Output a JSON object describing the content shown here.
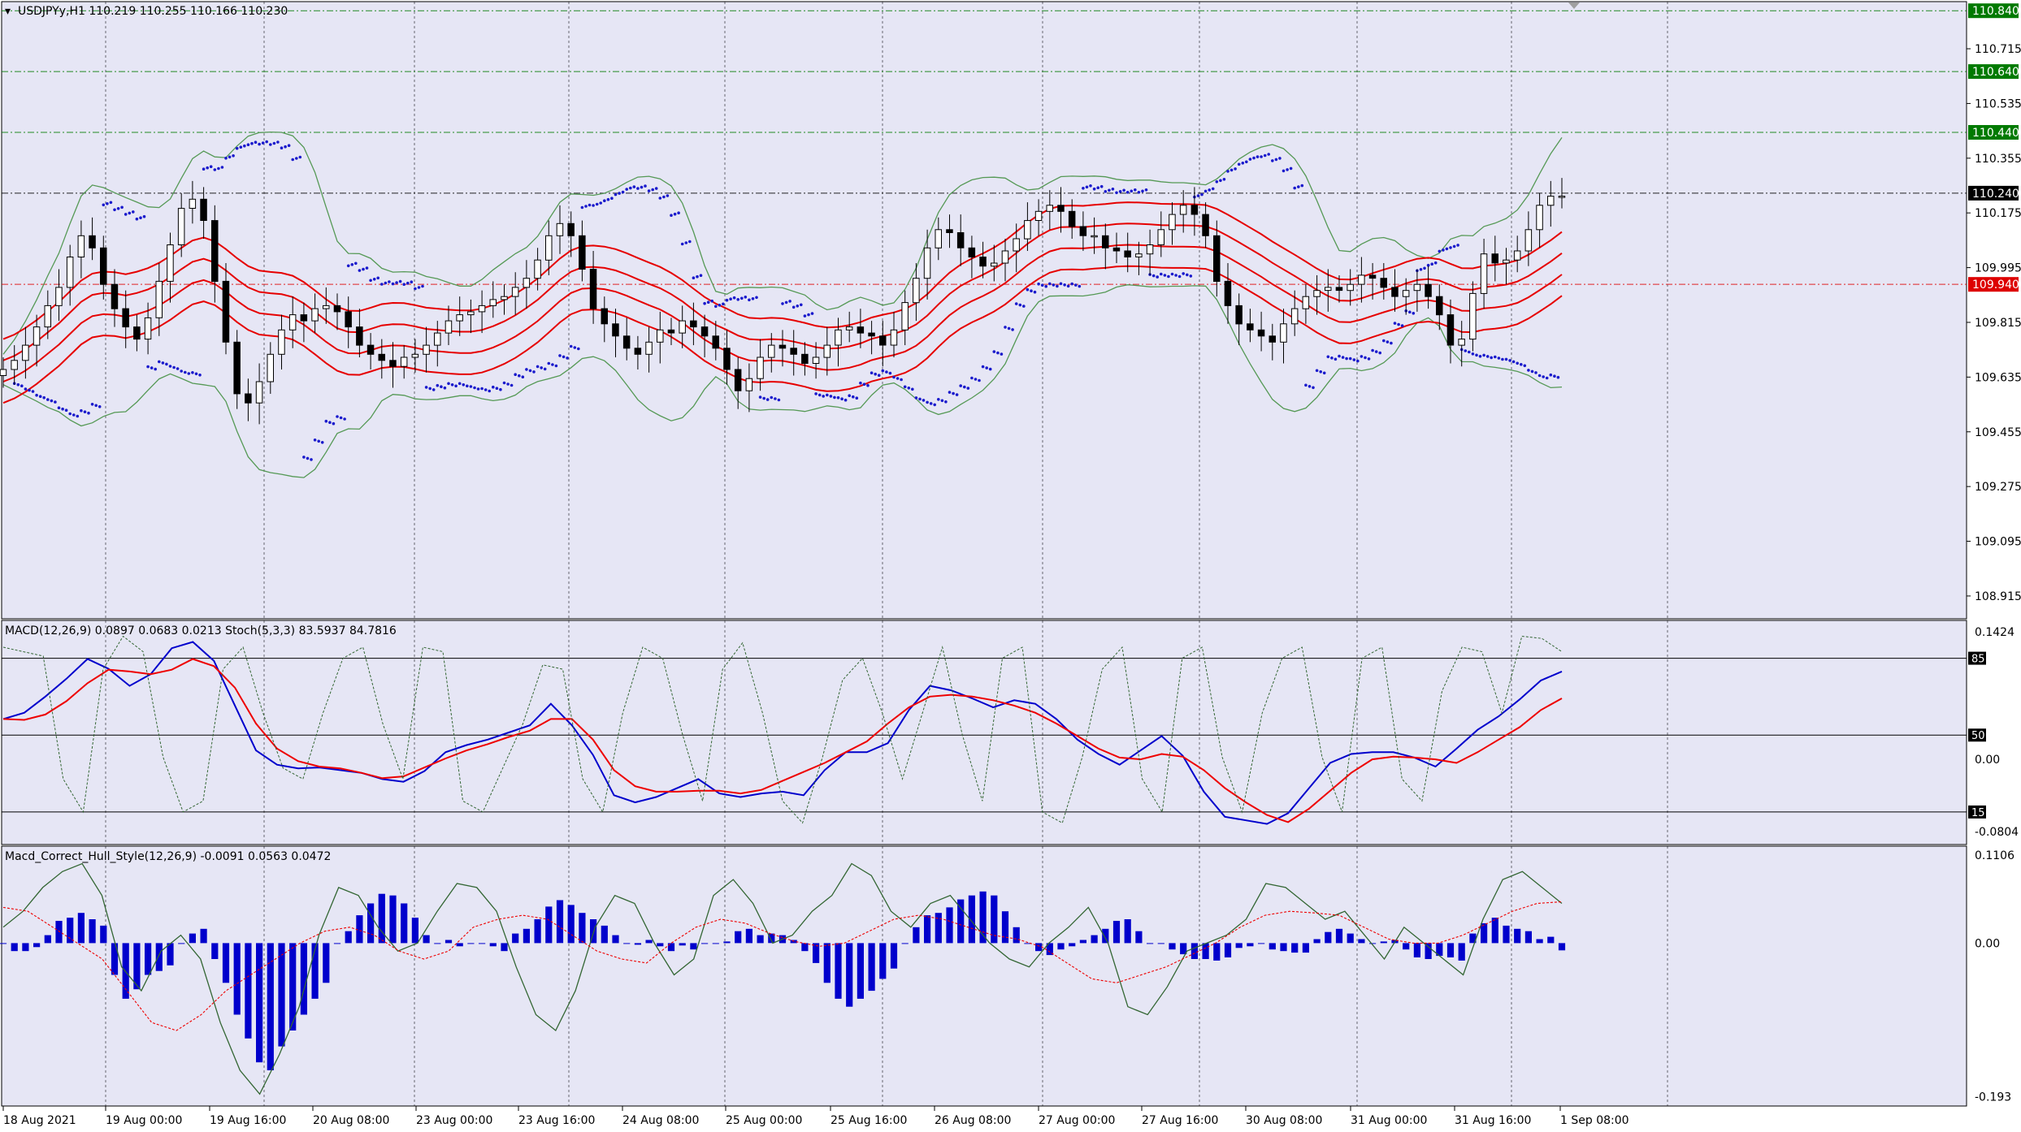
{
  "window": {
    "header": "USDJPYy,H1  110.219 110.255 110.166 110.230"
  },
  "panes": {
    "price": {
      "ticks": [
        "110.715",
        "110.535",
        "110.355",
        "110.175",
        "109.995",
        "109.815",
        "109.635",
        "109.455",
        "109.275",
        "109.095",
        "108.915"
      ]
    },
    "macd": {
      "label": "MACD(12,26,9) 0.0897 0.0683 0.0213  Stoch(5,3,3) 83.5937 84.7816",
      "ticks": [
        "0.1424",
        "0.00",
        "-0.0804"
      ],
      "level_labels": [
        "85",
        "50",
        "15"
      ]
    },
    "hull": {
      "label": "Macd_Correct_Hull_Style(12,26,9) -0.0091 0.0563 0.0472",
      "ticks": [
        "0.1106",
        "0.00",
        "-0.193"
      ]
    }
  },
  "price_tags": [
    "110.840",
    "110.640",
    "110.440",
    "110.240",
    "109.940"
  ],
  "time_labels": [
    "18 Aug 2021",
    "19 Aug 00:00",
    "19 Aug 16:00",
    "20 Aug 08:00",
    "23 Aug 00:00",
    "23 Aug 16:00",
    "24 Aug 08:00",
    "25 Aug 00:00",
    "25 Aug 16:00",
    "26 Aug 08:00",
    "27 Aug 00:00",
    "27 Aug 16:00",
    "30 Aug 08:00",
    "31 Aug 00:00",
    "31 Aug 16:00",
    "1 Sep 08:00"
  ],
  "colors": {
    "background": "#e6e6f5",
    "grid": "#000000",
    "bull_candle": "#ffffff",
    "bear_candle": "#000000",
    "ma_red": "#e60000",
    "bollinger": "#559955",
    "psar": "#1a1acc",
    "macd_blue": "#0000cc",
    "signal_red": "#ee0000",
    "stoch_green": "#336633",
    "tag_green": "#007a00",
    "tag_black": "#000000",
    "tag_red": "#dd0000"
  },
  "chart_data": [
    {
      "type": "candlestick",
      "symbol": "USDJPYy",
      "timeframe": "H1",
      "ohlc_last": {
        "open": 110.219,
        "high": 110.255,
        "low": 110.166,
        "close": 110.23
      },
      "ylim": [
        108.84,
        110.87
      ],
      "closes": [
        109.66,
        109.69,
        109.74,
        109.8,
        109.87,
        109.93,
        110.03,
        110.1,
        110.06,
        109.94,
        109.86,
        109.8,
        109.76,
        109.83,
        109.95,
        110.07,
        110.19,
        110.22,
        110.15,
        109.95,
        109.75,
        109.58,
        109.55,
        109.62,
        109.71,
        109.79,
        109.84,
        109.82,
        109.86,
        109.87,
        109.85,
        109.8,
        109.74,
        109.71,
        109.69,
        109.67,
        109.7,
        109.71,
        109.74,
        109.78,
        109.82,
        109.84,
        109.85,
        109.87,
        109.89,
        109.9,
        109.93,
        109.96,
        110.02,
        110.1,
        110.14,
        110.1,
        109.99,
        109.86,
        109.81,
        109.77,
        109.73,
        109.71,
        109.75,
        109.79,
        109.78,
        109.82,
        109.8,
        109.77,
        109.73,
        109.66,
        109.59,
        109.63,
        109.7,
        109.74,
        109.73,
        109.71,
        109.68,
        109.7,
        109.74,
        109.79,
        109.8,
        109.78,
        109.77,
        109.74,
        109.79,
        109.88,
        109.96,
        110.06,
        110.12,
        110.11,
        110.06,
        110.03,
        110.0,
        110.01,
        110.05,
        110.09,
        110.15,
        110.18,
        110.2,
        110.18,
        110.13,
        110.1,
        110.1,
        110.06,
        110.05,
        110.03,
        110.04,
        110.07,
        110.12,
        110.17,
        110.2,
        110.17,
        110.1,
        109.95,
        109.87,
        109.81,
        109.79,
        109.77,
        109.75,
        109.81,
        109.86,
        109.9,
        109.92,
        109.93,
        109.92,
        109.94,
        109.97,
        109.96,
        109.93,
        109.9,
        109.92,
        109.94,
        109.9,
        109.84,
        109.74,
        109.76,
        109.91,
        110.04,
        110.01,
        110.02,
        110.05,
        110.12,
        110.2,
        110.23,
        110.23
      ],
      "series_overlays": [
        "Bollinger Bands",
        "Envelope moving averages",
        "Parabolic SAR"
      ]
    },
    {
      "type": "line",
      "name": "MACD + Stochastic",
      "ylim": [
        -0.095,
        0.155
      ],
      "series": [
        {
          "name": "MACD",
          "values": [
            0.045,
            0.052,
            0.07,
            0.09,
            0.112,
            0.101,
            0.082,
            0.095,
            0.124,
            0.131,
            0.11,
            0.06,
            0.01,
            -0.006,
            -0.01,
            -0.009,
            -0.012,
            -0.015,
            -0.022,
            -0.025,
            -0.013,
            0.008,
            0.016,
            0.022,
            0.03,
            0.038,
            0.062,
            0.038,
            0.005,
            -0.04,
            -0.048,
            -0.042,
            -0.032,
            -0.022,
            -0.038,
            -0.042,
            -0.038,
            -0.036,
            -0.04,
            -0.012,
            0.008,
            0.008,
            0.018,
            0.055,
            0.082,
            0.077,
            0.068,
            0.058,
            0.066,
            0.062,
            0.045,
            0.022,
            0.006,
            -0.006,
            0.01,
            0.026,
            0.004,
            -0.036,
            -0.064,
            -0.068,
            -0.072,
            -0.06,
            -0.032,
            -0.004,
            0.006,
            0.008,
            0.008,
            0.002,
            -0.008,
            0.012,
            0.033,
            0.048,
            0.067,
            0.088,
            0.098
          ]
        },
        {
          "name": "Signal",
          "values": [
            0.045,
            0.044,
            0.05,
            0.065,
            0.085,
            0.1,
            0.098,
            0.095,
            0.1,
            0.112,
            0.104,
            0.08,
            0.04,
            0.012,
            -0.002,
            -0.008,
            -0.01,
            -0.015,
            -0.021,
            -0.019,
            -0.009,
            0.001,
            0.01,
            0.017,
            0.025,
            0.032,
            0.045,
            0.045,
            0.022,
            -0.012,
            -0.03,
            -0.036,
            -0.036,
            -0.035,
            -0.035,
            -0.038,
            -0.034,
            -0.024,
            -0.014,
            -0.004,
            0.008,
            0.02,
            0.04,
            0.058,
            0.07,
            0.072,
            0.07,
            0.066,
            0.06,
            0.052,
            0.04,
            0.026,
            0.012,
            0.002,
            0.0,
            0.006,
            0.003,
            -0.012,
            -0.032,
            -0.048,
            -0.062,
            -0.07,
            -0.055,
            -0.035,
            -0.015,
            0.0,
            0.003,
            0.002,
            0.0,
            -0.004,
            0.008,
            0.022,
            0.036,
            0.055,
            0.068
          ]
        },
        {
          "name": "Stochastic",
          "values": [
            90,
            88,
            86,
            30,
            15,
            80,
            95,
            88,
            40,
            15,
            20,
            80,
            90,
            60,
            35,
            30,
            60,
            85,
            90,
            55,
            30,
            90,
            88,
            20,
            15,
            35,
            55,
            82,
            80,
            30,
            15,
            60,
            90,
            85,
            50,
            20,
            80,
            92,
            60,
            20,
            10,
            40,
            75,
            85,
            60,
            30,
            60,
            90,
            50,
            20,
            85,
            90,
            15,
            10,
            40,
            80,
            90,
            30,
            15,
            85,
            90,
            40,
            15,
            60,
            85,
            90,
            40,
            15,
            85,
            90,
            30,
            20,
            70,
            90,
            88,
            60,
            95,
            94,
            88
          ]
        }
      ],
      "levels": [
        85,
        50,
        15
      ]
    },
    {
      "type": "bar",
      "name": "Macd_Correct_Hull_Style",
      "ylim": [
        -0.205,
        0.122
      ],
      "histogram": [
        0.0,
        -0.01,
        -0.01,
        -0.005,
        0.01,
        0.028,
        0.032,
        0.038,
        0.03,
        0.022,
        -0.04,
        -0.07,
        -0.058,
        -0.04,
        -0.035,
        -0.028,
        0.0,
        0.012,
        0.018,
        -0.02,
        -0.05,
        -0.09,
        -0.12,
        -0.15,
        -0.16,
        -0.13,
        -0.11,
        -0.09,
        -0.07,
        -0.05,
        0.0,
        0.015,
        0.035,
        0.05,
        0.062,
        0.06,
        0.05,
        0.032,
        0.01,
        0.0,
        0.004,
        -0.004,
        0.0,
        0.0,
        -0.004,
        -0.01,
        0.012,
        0.018,
        0.03,
        0.046,
        0.054,
        0.048,
        0.038,
        0.03,
        0.022,
        0.01,
        0.0,
        -0.002,
        0.004,
        -0.004,
        -0.01,
        -0.003,
        -0.008,
        0.0,
        0.0,
        0.002,
        0.015,
        0.018,
        0.01,
        0.012,
        0.01,
        0.004,
        -0.01,
        -0.025,
        -0.05,
        -0.07,
        -0.08,
        -0.07,
        -0.06,
        -0.045,
        -0.032,
        0.0,
        0.02,
        0.035,
        0.038,
        0.045,
        0.055,
        0.06,
        0.065,
        0.06,
        0.04,
        0.02,
        0.0,
        -0.01,
        -0.015,
        -0.008,
        -0.004,
        0.004,
        0.01,
        0.018,
        0.028,
        0.03,
        0.015,
        0.0,
        0.0,
        -0.008,
        -0.014,
        -0.02,
        -0.02,
        -0.022,
        -0.018,
        -0.006,
        -0.004,
        0.0,
        -0.008,
        -0.01,
        -0.012,
        -0.012,
        0.005,
        0.014,
        0.018,
        0.012,
        0.005,
        0.0,
        0.002,
        0.004,
        -0.008,
        -0.018,
        -0.02,
        -0.016,
        -0.018,
        -0.022,
        0.012,
        0.025,
        0.032,
        0.022,
        0.018,
        0.015,
        0.005,
        0.008,
        -0.0091
      ],
      "series": [
        {
          "name": "Signal line",
          "values": [
            0.02,
            0.04,
            0.07,
            0.09,
            0.1,
            0.06,
            -0.03,
            -0.06,
            -0.01,
            0.01,
            -0.02,
            -0.1,
            -0.16,
            -0.19,
            -0.14,
            -0.08,
            0.01,
            0.07,
            0.06,
            0.02,
            -0.01,
            0.0,
            0.04,
            0.075,
            0.07,
            0.04,
            -0.03,
            -0.09,
            -0.11,
            -0.06,
            0.02,
            0.06,
            0.05,
            0.0,
            -0.04,
            -0.02,
            0.06,
            0.08,
            0.05,
            0.0,
            0.01,
            0.04,
            0.06,
            0.1,
            0.085,
            0.04,
            0.02,
            0.05,
            0.06,
            0.03,
            0.0,
            -0.02,
            -0.03,
            0.0,
            0.02,
            0.045,
            0.0,
            -0.08,
            -0.09,
            -0.055,
            -0.01,
            0.0,
            0.01,
            0.03,
            0.075,
            0.07,
            0.05,
            0.03,
            0.04,
            0.01,
            -0.02,
            0.02,
            0.0,
            -0.02,
            -0.04,
            0.03,
            0.08,
            0.09,
            0.07,
            0.05
          ]
        },
        {
          "name": "MA line",
          "values": [
            0.045,
            0.04,
            0.02,
            0.0,
            -0.02,
            -0.06,
            -0.1,
            -0.11,
            -0.09,
            -0.06,
            -0.04,
            -0.02,
            0.0,
            0.015,
            0.02,
            0.01,
            -0.01,
            -0.02,
            -0.01,
            0.02,
            0.03,
            0.035,
            0.03,
            0.01,
            -0.01,
            -0.02,
            -0.025,
            0.0,
            0.02,
            0.03,
            0.025,
            0.012,
            0.002,
            -0.004,
            0.0,
            0.015,
            0.03,
            0.035,
            0.03,
            0.02,
            0.01,
            0.005,
            -0.005,
            -0.025,
            -0.045,
            -0.05,
            -0.04,
            -0.03,
            -0.015,
            0.0,
            0.02,
            0.035,
            0.04,
            0.038,
            0.035,
            0.02,
            0.005,
            0.0,
            0.0,
            0.01,
            0.025,
            0.04,
            0.05,
            0.052
          ]
        }
      ]
    }
  ]
}
